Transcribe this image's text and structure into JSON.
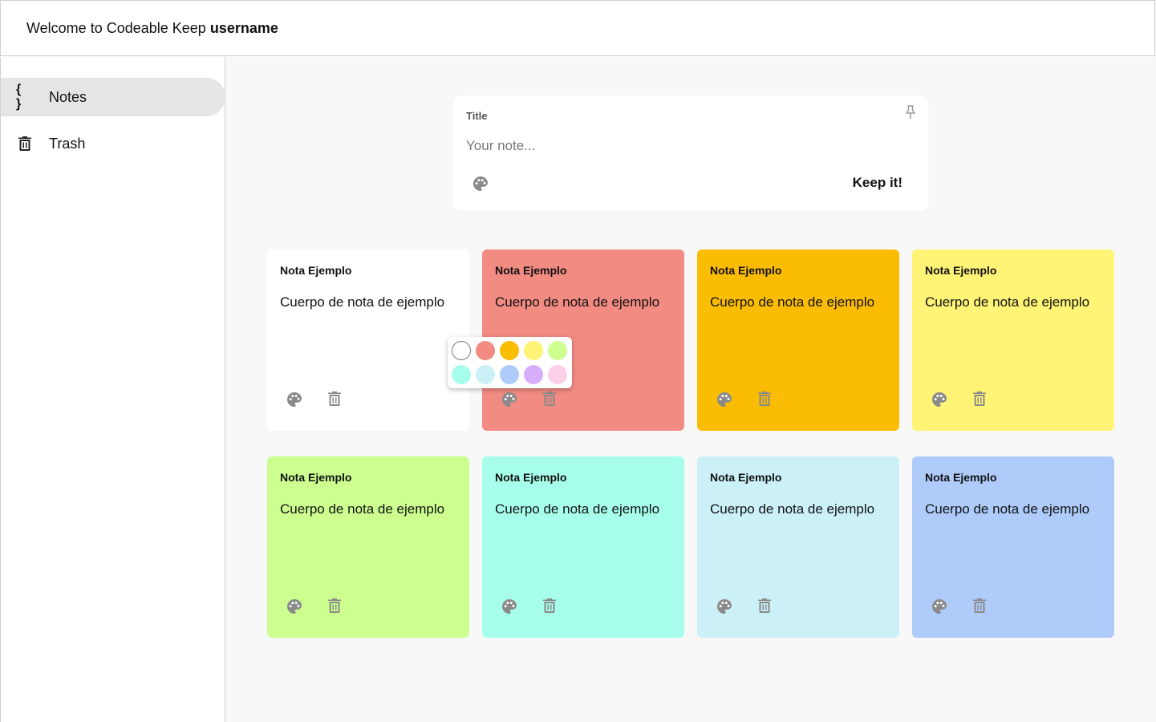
{
  "header": {
    "welcome_text": "Welcome to Codeable Keep",
    "username": "username"
  },
  "sidebar": {
    "items": [
      {
        "label": "Notes",
        "icon": "braces-icon",
        "active": true
      },
      {
        "label": "Trash",
        "icon": "trash-icon",
        "active": false
      }
    ]
  },
  "composer": {
    "title_placeholder": "Title",
    "note_placeholder": "Your note...",
    "keep_label": "Keep it!"
  },
  "notes": [
    {
      "title": "Nota Ejemplo",
      "body": "Cuerpo de nota de ejemplo",
      "color": "#ffffff"
    },
    {
      "title": "Nota Ejemplo",
      "body": "Cuerpo de nota de ejemplo",
      "color": "#f28b82"
    },
    {
      "title": "Nota Ejemplo",
      "body": "Cuerpo de nota de ejemplo",
      "color": "#fbbc04"
    },
    {
      "title": "Nota Ejemplo",
      "body": "Cuerpo de nota de ejemplo",
      "color": "#fff475"
    },
    {
      "title": "Nota Ejemplo",
      "body": "Cuerpo de nota de ejemplo",
      "color": "#ccff90"
    },
    {
      "title": "Nota Ejemplo",
      "body": "Cuerpo de nota de ejemplo",
      "color": "#a7ffeb"
    },
    {
      "title": "Nota Ejemplo",
      "body": "Cuerpo de nota de ejemplo",
      "color": "#cbf0f8"
    },
    {
      "title": "Nota Ejemplo",
      "body": "Cuerpo de nota de ejemplo",
      "color": "#aecbfa"
    }
  ],
  "color_picker": {
    "colors": [
      "#ffffff",
      "#f28b82",
      "#fbbc04",
      "#fff475",
      "#ccff90",
      "#a7ffeb",
      "#cbf0f8",
      "#aecbfa",
      "#d7aefb",
      "#fdcfe8"
    ]
  },
  "icons": {
    "action_color": "#8a8a8a",
    "palette": "palette-icon",
    "trash": "trash-icon",
    "pin": "pin-icon"
  }
}
